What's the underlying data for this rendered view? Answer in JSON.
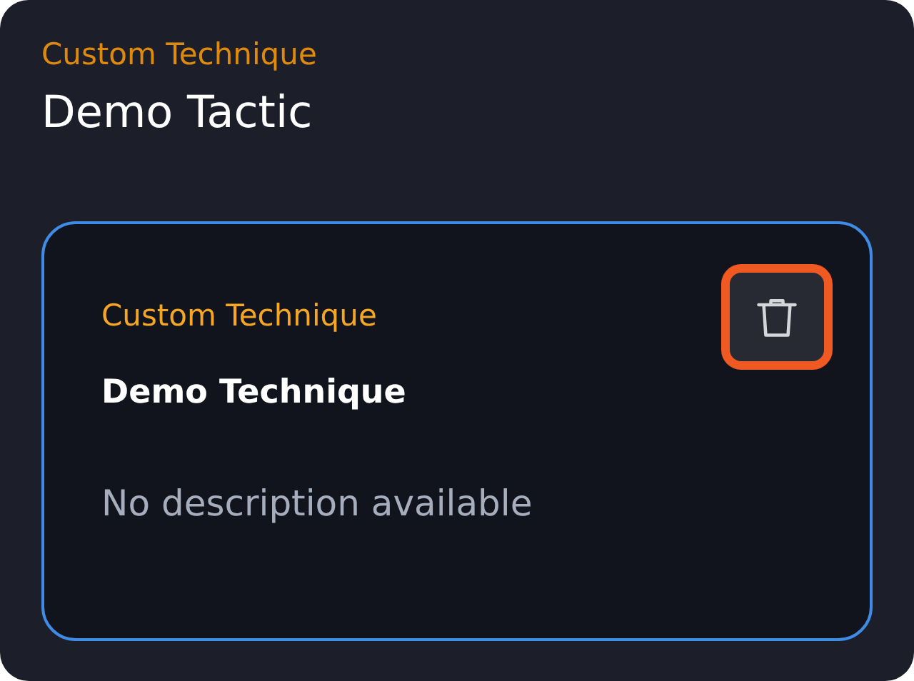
{
  "tactic": {
    "category": "Custom Technique",
    "title": "Demo Tactic"
  },
  "techniques": [
    {
      "category": "Custom Technique",
      "title": "Demo Technique",
      "description": "No description available",
      "delete_highlighted": true
    }
  ]
}
